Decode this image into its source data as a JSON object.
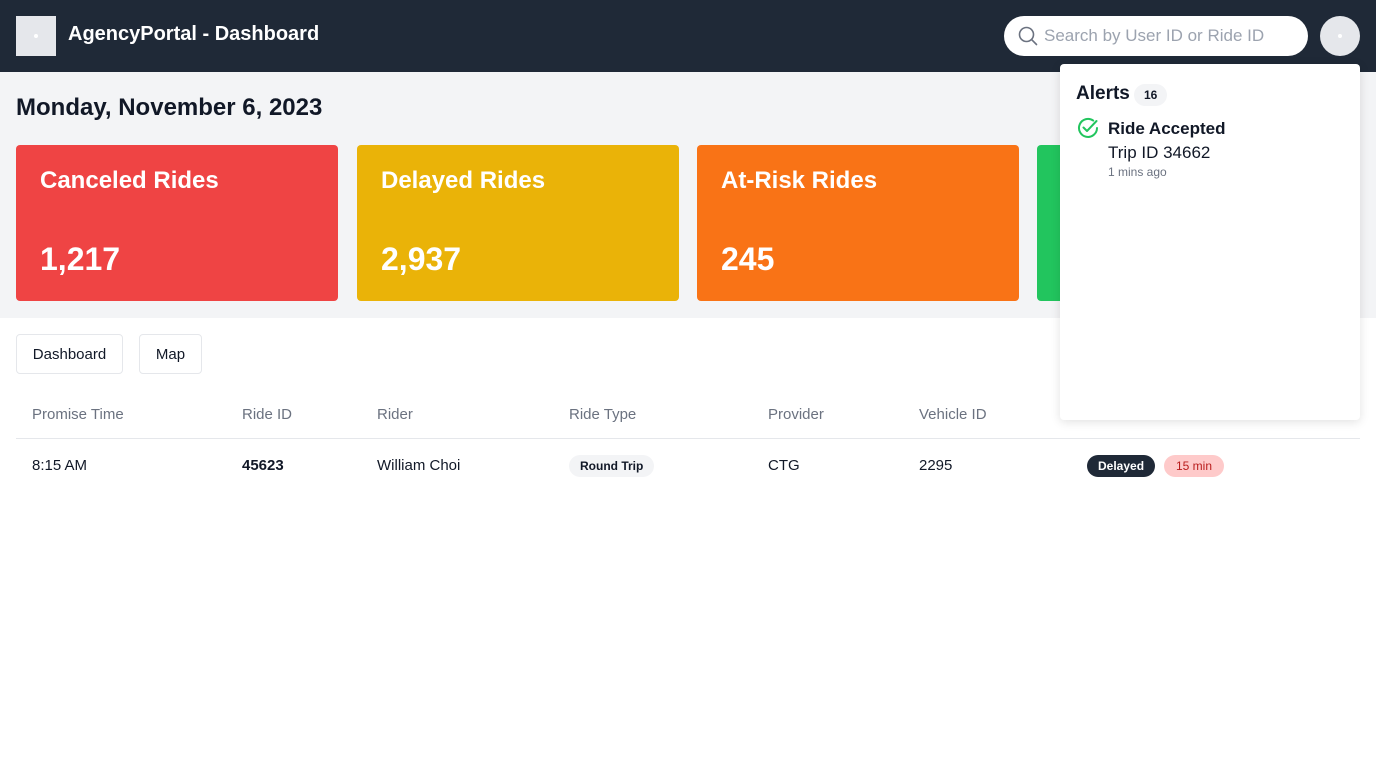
{
  "app": {
    "title": "AgencyPortal - Dashboard",
    "search_placeholder": "Search by User ID or Ride ID"
  },
  "colors": {
    "topbar": "#1f2937",
    "canceled": "#ef4444",
    "delayed": "#eab308",
    "at_risk": "#f97316",
    "on_time": "#22c55e"
  },
  "summary": {
    "date": "Monday, November 6, 2023",
    "cards": [
      {
        "title": "Canceled Rides",
        "value": "1,217"
      },
      {
        "title": "Delayed Rides",
        "value": "2,937"
      },
      {
        "title": "At-Risk Rides",
        "value": "245"
      }
    ]
  },
  "nav": {
    "dashboard": "Dashboard",
    "map": "Map"
  },
  "table": {
    "columns": [
      "Promise Time",
      "Ride ID",
      "Rider",
      "Ride Type",
      "Provider",
      "Vehicle ID"
    ],
    "rows": [
      {
        "promise_time": "8:15 AM",
        "ride_id": "45623",
        "rider": "William Choi",
        "ride_type": "Round Trip",
        "provider": "CTG",
        "vehicle_id": "2295",
        "status": "Delayed",
        "delay": "15 min"
      }
    ]
  },
  "alerts": {
    "title": "Alerts",
    "count": "16",
    "items": [
      {
        "icon": "check-circle-icon",
        "title": "Ride Accepted",
        "body": "Trip ID 34662",
        "time": "1 mins ago"
      }
    ]
  }
}
